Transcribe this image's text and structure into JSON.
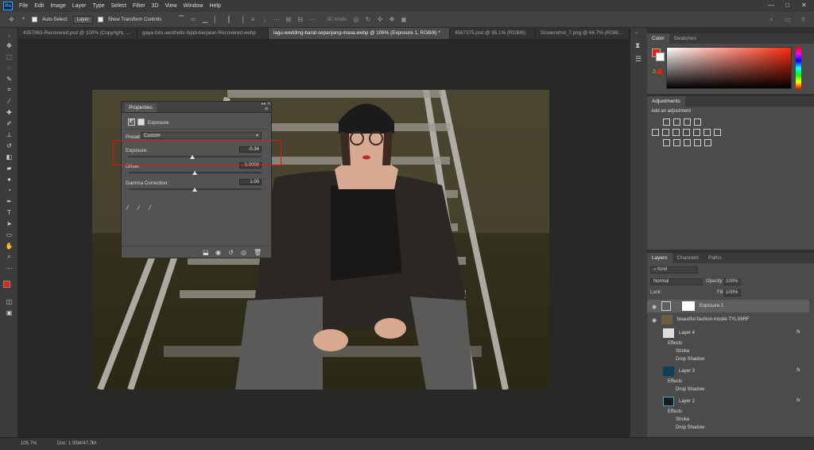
{
  "app": {
    "logo": "Ps"
  },
  "menu": [
    "File",
    "Edit",
    "Image",
    "Layer",
    "Type",
    "Select",
    "Filter",
    "3D",
    "View",
    "Window",
    "Help"
  ],
  "window_controls": [
    "—",
    "□",
    "✕"
  ],
  "options_bar": {
    "auto_select_label": "Auto-Select:",
    "auto_select_value": "Layer",
    "show_transform_label": "Show Transform Controls",
    "mode_3d_label": "3D Mode:"
  },
  "doc_tabs": [
    {
      "label": "4357963-Recovered.psd @ 100% (Copyright, ...",
      "active": false
    },
    {
      "label": "gaya-foto-aesthetic-hijab-berjalan-Recovered.webp",
      "active": false
    },
    {
      "label": "lagu-wedding-barat-sepanjang-masa.webp @ 106% (Exposure 1, RGB/8) *",
      "active": true
    },
    {
      "label": "4567375.psd @ 95.1% (RGB/8)",
      "active": false
    },
    {
      "label": "Screenshot_7.png @ 66.7% (RGB/...",
      "active": false
    }
  ],
  "properties": {
    "tab": "Properties",
    "type_label": "Exposure",
    "preset_label": "Preset:",
    "preset_value": "Custom",
    "exposure_label": "Exposure:",
    "exposure_value": "-0.34",
    "offset_label": "Offset:",
    "offset_value": "0.0000",
    "gamma_label": "Gamma Correction:",
    "gamma_value": "1.00",
    "exposure_slider": 0.48,
    "offset_slider": 0.5,
    "gamma_slider": 0.5
  },
  "colors": {
    "foreground": "#e8200c",
    "background": "#ffffff",
    "highlight_box": "#e01414",
    "ps_accent": "#31a8ff"
  },
  "right_panel": {
    "color_tabs": [
      "Color",
      "Swatches"
    ],
    "adjustments_tab": "Adjustments",
    "add_adjustment_label": "Add an adjustment",
    "layer_tabs": [
      "Layers",
      "Channels",
      "Paths"
    ],
    "kind_filter": "Kind",
    "blend_mode": "Normal",
    "opacity_label": "Opacity:",
    "opacity_value": "100%",
    "lock_label": "Lock:",
    "fill_label": "Fill:",
    "fill_value": "100%"
  },
  "layers": [
    {
      "name": "Exposure 1",
      "type": "adjustment",
      "visible": true,
      "selected": true
    },
    {
      "name": "beautiful-fashion-model-TYLS6RF",
      "type": "image",
      "visible": true
    },
    {
      "name": "Layer 4",
      "type": "layer",
      "fx": "fx",
      "effects_label": "Effects",
      "effects": [
        "Stroke",
        "Drop Shadow"
      ]
    },
    {
      "name": "Layer 3",
      "type": "layer",
      "fx": "fx",
      "effects_label": "Effects",
      "effects": [
        "Drop Shadow"
      ]
    },
    {
      "name": "Layer 2",
      "type": "layer",
      "fx": "fx",
      "effects_label": "Effects",
      "effects": [
        "Stroke",
        "Drop Shadow"
      ]
    }
  ],
  "status": {
    "zoom": "105.7%",
    "doc": "Doc: 1.95M/47.7M"
  }
}
